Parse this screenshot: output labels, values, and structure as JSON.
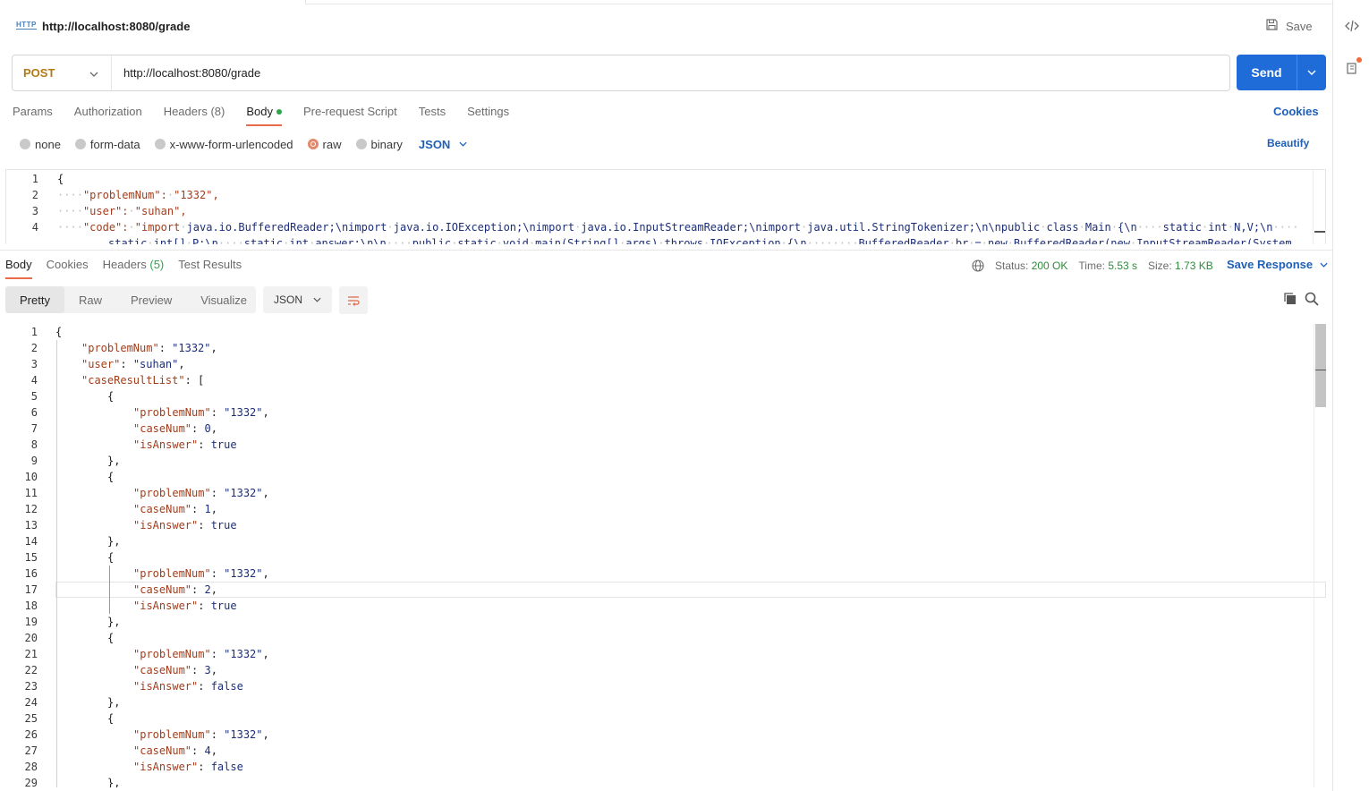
{
  "header": {
    "http_badge": "HTTP",
    "request_name": "http://localhost:8080/grade",
    "save_label": "Save"
  },
  "urlbar": {
    "method": "POST",
    "url": "http://localhost:8080/grade",
    "send_label": "Send"
  },
  "request_tabs": {
    "params": "Params",
    "authorization": "Authorization",
    "headers": "Headers",
    "headers_count": "(8)",
    "body": "Body",
    "prerequest": "Pre-request Script",
    "tests": "Tests",
    "settings": "Settings",
    "cookies": "Cookies"
  },
  "body_types": {
    "none": "none",
    "form_data": "form-data",
    "urlencoded": "x-www-form-urlencoded",
    "raw": "raw",
    "binary": "binary",
    "format": "JSON",
    "selected": "raw",
    "beautify": "Beautify"
  },
  "request_body": {
    "lines": [
      {
        "n": "1",
        "t": "{"
      },
      {
        "n": "2",
        "t": "····\"problemNum\":·\"1332\","
      },
      {
        "n": "3",
        "t": "····\"user\":·\"suhan\","
      },
      {
        "n": "4",
        "t": "····\"code\":·\"import·java.io.BufferedReader;\\nimport·java.io.IOException;\\nimport·java.io.InputStreamReader;\\nimport·java.util.StringTokenizer;\\n\\npublic·class·Main·{\\n····static·int·N,V;\\n····"
      },
      {
        "n": "",
        "t": "static·int[]·P;\\n····static·int·answer;\\n\\n····public·static·void·main(String[]·args)·throws·IOException·{\\n········BufferedReader·br·=·new·BufferedReader(new·InputStreamReader(System."
      }
    ]
  },
  "response_tabs": {
    "body": "Body",
    "cookies": "Cookies",
    "headers": "Headers",
    "headers_count": "(5)",
    "test_results": "Test Results"
  },
  "response_meta": {
    "status_label": "Status:",
    "status_value": "200 OK",
    "time_label": "Time:",
    "time_value": "5.53 s",
    "size_label": "Size:",
    "size_value": "1.73 KB",
    "save_response": "Save Response"
  },
  "views": {
    "pretty": "Pretty",
    "raw": "Raw",
    "preview": "Preview",
    "visualize": "Visualize",
    "format": "JSON"
  },
  "response_body": {
    "lines": [
      {
        "n": "1",
        "i": 0,
        "t": [
          [
            "p",
            "{"
          ]
        ]
      },
      {
        "n": "2",
        "i": 1,
        "t": [
          [
            "k",
            "\"problemNum\""
          ],
          [
            "p",
            ": "
          ],
          [
            "s",
            "\"1332\""
          ],
          [
            "p",
            ","
          ]
        ]
      },
      {
        "n": "3",
        "i": 1,
        "t": [
          [
            "k",
            "\"user\""
          ],
          [
            "p",
            ": "
          ],
          [
            "s",
            "\"suhan\""
          ],
          [
            "p",
            ","
          ]
        ]
      },
      {
        "n": "4",
        "i": 1,
        "t": [
          [
            "k",
            "\"caseResultList\""
          ],
          [
            "p",
            ": ["
          ]
        ]
      },
      {
        "n": "5",
        "i": 2,
        "t": [
          [
            "p",
            "{"
          ]
        ]
      },
      {
        "n": "6",
        "i": 3,
        "t": [
          [
            "k",
            "\"problemNum\""
          ],
          [
            "p",
            ": "
          ],
          [
            "s",
            "\"1332\""
          ],
          [
            "p",
            ","
          ]
        ]
      },
      {
        "n": "7",
        "i": 3,
        "t": [
          [
            "k",
            "\"caseNum\""
          ],
          [
            "p",
            ": "
          ],
          [
            "b",
            "0"
          ],
          [
            "p",
            ","
          ]
        ]
      },
      {
        "n": "8",
        "i": 3,
        "t": [
          [
            "k",
            "\"isAnswer\""
          ],
          [
            "p",
            ": "
          ],
          [
            "b",
            "true"
          ]
        ]
      },
      {
        "n": "9",
        "i": 2,
        "t": [
          [
            "p",
            "},"
          ]
        ]
      },
      {
        "n": "10",
        "i": 2,
        "t": [
          [
            "p",
            "{"
          ]
        ]
      },
      {
        "n": "11",
        "i": 3,
        "t": [
          [
            "k",
            "\"problemNum\""
          ],
          [
            "p",
            ": "
          ],
          [
            "s",
            "\"1332\""
          ],
          [
            "p",
            ","
          ]
        ]
      },
      {
        "n": "12",
        "i": 3,
        "t": [
          [
            "k",
            "\"caseNum\""
          ],
          [
            "p",
            ": "
          ],
          [
            "b",
            "1"
          ],
          [
            "p",
            ","
          ]
        ]
      },
      {
        "n": "13",
        "i": 3,
        "t": [
          [
            "k",
            "\"isAnswer\""
          ],
          [
            "p",
            ": "
          ],
          [
            "b",
            "true"
          ]
        ]
      },
      {
        "n": "14",
        "i": 2,
        "t": [
          [
            "p",
            "},"
          ]
        ]
      },
      {
        "n": "15",
        "i": 2,
        "t": [
          [
            "p",
            "{"
          ]
        ]
      },
      {
        "n": "16",
        "i": 3,
        "t": [
          [
            "k",
            "\"problemNum\""
          ],
          [
            "p",
            ": "
          ],
          [
            "s",
            "\"1332\""
          ],
          [
            "p",
            ","
          ]
        ]
      },
      {
        "n": "17",
        "i": 3,
        "t": [
          [
            "k",
            "\"caseNum\""
          ],
          [
            "p",
            ": "
          ],
          [
            "b",
            "2"
          ],
          [
            "p",
            ","
          ]
        ]
      },
      {
        "n": "18",
        "i": 3,
        "t": [
          [
            "k",
            "\"isAnswer\""
          ],
          [
            "p",
            ": "
          ],
          [
            "b",
            "true"
          ]
        ]
      },
      {
        "n": "19",
        "i": 2,
        "t": [
          [
            "p",
            "},"
          ]
        ]
      },
      {
        "n": "20",
        "i": 2,
        "t": [
          [
            "p",
            "{"
          ]
        ]
      },
      {
        "n": "21",
        "i": 3,
        "t": [
          [
            "k",
            "\"problemNum\""
          ],
          [
            "p",
            ": "
          ],
          [
            "s",
            "\"1332\""
          ],
          [
            "p",
            ","
          ]
        ]
      },
      {
        "n": "22",
        "i": 3,
        "t": [
          [
            "k",
            "\"caseNum\""
          ],
          [
            "p",
            ": "
          ],
          [
            "b",
            "3"
          ],
          [
            "p",
            ","
          ]
        ]
      },
      {
        "n": "23",
        "i": 3,
        "t": [
          [
            "k",
            "\"isAnswer\""
          ],
          [
            "p",
            ": "
          ],
          [
            "b",
            "false"
          ]
        ]
      },
      {
        "n": "24",
        "i": 2,
        "t": [
          [
            "p",
            "},"
          ]
        ]
      },
      {
        "n": "25",
        "i": 2,
        "t": [
          [
            "p",
            "{"
          ]
        ]
      },
      {
        "n": "26",
        "i": 3,
        "t": [
          [
            "k",
            "\"problemNum\""
          ],
          [
            "p",
            ": "
          ],
          [
            "s",
            "\"1332\""
          ],
          [
            "p",
            ","
          ]
        ]
      },
      {
        "n": "27",
        "i": 3,
        "t": [
          [
            "k",
            "\"caseNum\""
          ],
          [
            "p",
            ": "
          ],
          [
            "b",
            "4"
          ],
          [
            "p",
            ","
          ]
        ]
      },
      {
        "n": "28",
        "i": 3,
        "t": [
          [
            "k",
            "\"isAnswer\""
          ],
          [
            "p",
            ": "
          ],
          [
            "b",
            "false"
          ]
        ]
      },
      {
        "n": "29",
        "i": 2,
        "t": [
          [
            "p",
            "},"
          ]
        ]
      }
    ]
  },
  "colors": {
    "accent": "#1f6bd8",
    "tab_underline": "#e86b4a",
    "status_ok": "#2e8b3a",
    "method_post": "#b37b18"
  },
  "icons": {
    "http": "http-file-icon",
    "save": "floppy-disk-icon",
    "code": "code-brackets-icon",
    "docs": "document-icon",
    "globe": "globe-icon",
    "copy": "copy-icon",
    "search": "search-icon",
    "wrap": "wrap-lines-icon"
  }
}
